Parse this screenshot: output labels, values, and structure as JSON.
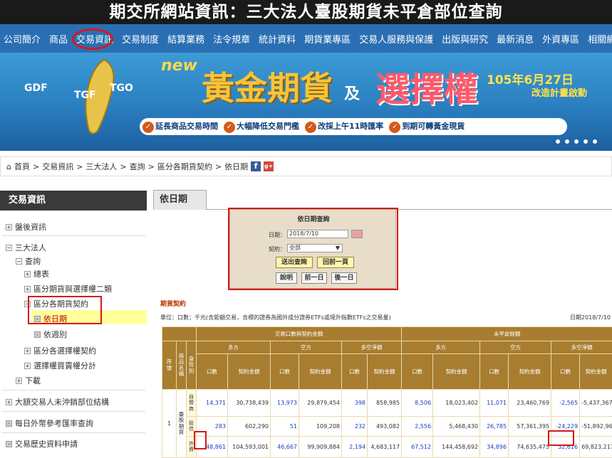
{
  "title": "期交所網站資訊：三大法人臺股期貨未平倉部位查詢",
  "nav": [
    "公司簡介",
    "商品",
    "交易資訊",
    "交易制度",
    "結算業務",
    "法令規章",
    "統計資料",
    "期貨業專區",
    "交易人服務與保護",
    "出版與研究",
    "最新消息",
    "外資專區",
    "相關網站"
  ],
  "banner": {
    "map_labels": [
      "GDF",
      "TGF",
      "TGO"
    ],
    "new": "new",
    "gold": "黃金期貨",
    "and": "及",
    "options": "選擇權",
    "date": "105年6月27日",
    "date_sub": "改造計畫啟動",
    "strip": [
      "延長商品交易時間",
      "大幅降低交易門檻",
      "改採上午11時匯率",
      "到期可轉黃金現貨"
    ],
    "check": "✓"
  },
  "breadcrumb": [
    "首頁",
    "交易資訊",
    "三大法人",
    "查詢",
    "區分各期貨契約",
    "依日期"
  ],
  "crumb_sep": ">",
  "fb": "f",
  "gp": "g+",
  "sidebar": {
    "header": "交易資訊",
    "items": [
      "盤後資訊",
      "三大法人",
      "查詢",
      "總表",
      "區分期貨與選擇權二類",
      "區分各期貨契約",
      "依日期",
      "依週別",
      "區分各選擇權契約",
      "選擇權買賣權分計",
      "下載",
      "大額交易人未沖銷部位結構",
      "每日外幣參考匯率查詢",
      "交易歷史資料申請"
    ],
    "marks": [
      "+",
      "−",
      "−",
      "+",
      "+",
      "−",
      "-",
      "-",
      "+",
      "+",
      "+",
      "+",
      "-",
      "-"
    ]
  },
  "main": {
    "tab": "依日期",
    "query": {
      "title": "依日期查詢",
      "date_label": "日期：",
      "date_value": "2018/7/10",
      "contract_label": "契約：",
      "contract_value": "全部",
      "btn_submit": "送出查詢",
      "btn_prev_page": "回前一頁",
      "btn_help": "說明",
      "btn_prev_day": "前一日",
      "btn_next_day": "後一日"
    },
    "section": "期貨契約",
    "unit": "單位：口數；千元(含鉅額交易，含標的證券為國外成分證券ETFs或境外指數ETFs之交易量)",
    "date": "日期2018/7/10",
    "table": {
      "h_trade": "交易口數與契約金額",
      "h_oi": "未平倉餘額",
      "h_long": "多方",
      "h_short": "空方",
      "h_net": "多空淨額",
      "h_seq": "序號",
      "h_prod": "商品名稱",
      "h_id": "身份別",
      "h_qty": "口數",
      "h_amt": "契約金額",
      "seq": "1",
      "product": "臺股期貨",
      "rows": [
        {
          "id": "自營商",
          "v": [
            "14,371",
            "30,738,439",
            "13,973",
            "29,879,454",
            "398",
            "858,985",
            "8,506",
            "18,023,402",
            "11,071",
            "23,460,769",
            "-2,565",
            "-5,437,367"
          ]
        },
        {
          "id": "投信",
          "v": [
            "283",
            "602,290",
            "51",
            "109,208",
            "232",
            "493,082",
            "2,556",
            "5,468,430",
            "26,785",
            "57,361,395",
            "-24,229",
            "-51,892,965"
          ]
        },
        {
          "id": "外資",
          "v": [
            "48,861",
            "104,593,001",
            "46,667",
            "99,909,884",
            "2,194",
            "4,683,117",
            "67,512",
            "144,458,692",
            "34,896",
            "74,635,475",
            "32,616",
            "69,823,217"
          ]
        }
      ]
    }
  }
}
